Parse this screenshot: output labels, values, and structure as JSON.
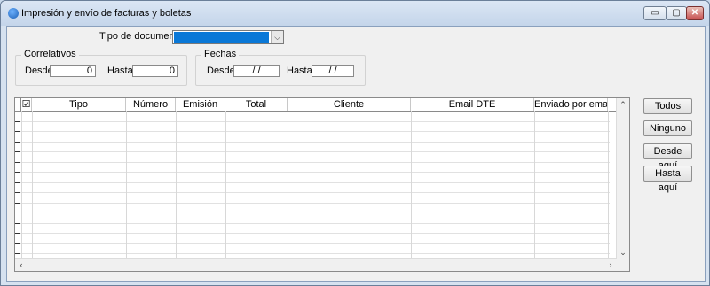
{
  "window": {
    "title": "Impresión y envío de facturas y boletas",
    "buttons": {
      "minimize": "▭",
      "maximize": "▢",
      "close": "✕"
    }
  },
  "form": {
    "tipo_documento_label": "Tipo de documento",
    "tipo_documento_value": "",
    "correlativos": {
      "legend": "Correlativos",
      "desde_label": "Desde",
      "desde_value": "0",
      "hasta_label": "Hasta",
      "hasta_value": "0"
    },
    "fechas": {
      "legend": "Fechas",
      "desde_label": "Desde",
      "desde_value": "/ /",
      "hasta_label": "Hasta",
      "hasta_value": "/ /"
    }
  },
  "table": {
    "columns": [
      "☑",
      "Tipo",
      "Número",
      "Emisión",
      "Total",
      "Cliente",
      "Email DTE",
      "Enviado por email",
      ""
    ],
    "rows": []
  },
  "side_buttons": {
    "todos": "Todos",
    "ninguno": "Ninguno",
    "desde_aqui": "Desde aquí",
    "hasta_aqui": "Hasta aquí"
  },
  "icons": {
    "app": "app-globe-icon",
    "combo_arrow": "chevron-down-icon",
    "scroll_up": "chevron-up-icon",
    "scroll_down": "chevron-down-icon",
    "scroll_left": "chevron-left-icon",
    "scroll_right": "chevron-right-icon"
  },
  "colors": {
    "accent": "#0a78d7",
    "titlebar": "#c4d5ea",
    "close": "#c75050"
  }
}
